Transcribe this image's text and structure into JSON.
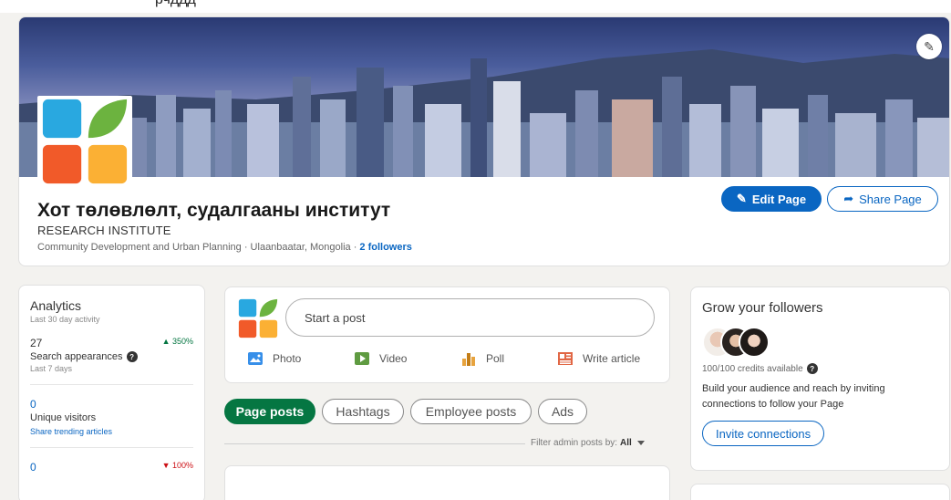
{
  "top_fragment": "рчддд",
  "header": {
    "org_name": "Хот төлөвлөлт, судалгааны институт",
    "org_type": "RESEARCH INSTITUTE",
    "meta": "Community Development and Urban Planning · Ulaanbaatar, Mongolia ·",
    "followers": "2 followers",
    "edit_page": "Edit Page",
    "share_page": "Share Page"
  },
  "analytics": {
    "title": "Analytics",
    "subtitle": "Last 30 day activity",
    "metrics": [
      {
        "value": "27",
        "change": "▲ 350%",
        "label": "Search appearances",
        "sublabel": "Last 7 days"
      },
      {
        "value": "0",
        "label": "Unique visitors",
        "link": "Share trending articles"
      },
      {
        "value": "0",
        "change": "▼ 100%"
      }
    ]
  },
  "composer": {
    "placeholder": "Start a post",
    "actions": [
      "Photo",
      "Video",
      "Poll",
      "Write article"
    ]
  },
  "tabs": [
    "Page posts",
    "Hashtags",
    "Employee posts",
    "Ads"
  ],
  "filter": {
    "label": "Filter admin posts by:",
    "value": "All"
  },
  "grow": {
    "title": "Grow your followers",
    "credits": "100/100 credits available",
    "description": "Build your audience and reach by inviting connections to follow your Page",
    "invite": "Invite connections"
  },
  "colors": {
    "primary": "#0a66c2",
    "active_tab": "#057642",
    "logo_blue": "#29a8e0",
    "logo_green": "#6cb33f",
    "logo_red": "#f15a29",
    "logo_yellow": "#fbb034"
  }
}
